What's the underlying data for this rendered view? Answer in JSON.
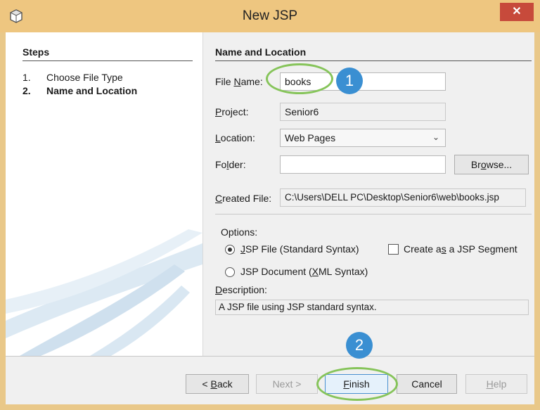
{
  "window": {
    "title": "New JSP",
    "close_glyph": "✕",
    "app_icon": "netbeans-cube-icon"
  },
  "steps": {
    "heading": "Steps",
    "items": [
      {
        "num": "1.",
        "label": "Choose File Type",
        "active": false
      },
      {
        "num": "2.",
        "label": "Name and Location",
        "active": true
      }
    ]
  },
  "form": {
    "heading": "Name and Location",
    "file_name": {
      "label_pre": "File ",
      "label_u": "N",
      "label_post": "ame:",
      "value": "books"
    },
    "project": {
      "label_u": "P",
      "label_post": "roject:",
      "value": "Senior6"
    },
    "location": {
      "label_u": "L",
      "label_post": "ocation:",
      "value": "Web Pages"
    },
    "folder": {
      "label_pre": "Fo",
      "label_u": "l",
      "label_post": "der:",
      "value": ""
    },
    "browse": {
      "label_pre": "Br",
      "label_u": "o",
      "label_post": "wse..."
    },
    "created_file": {
      "label_u": "C",
      "label_post": "reated File:",
      "value": "C:\\Users\\DELL PC\\Desktop\\Senior6\\web\\books.jsp"
    },
    "options_label": "Options:",
    "option_jsp_file": {
      "label_u": "J",
      "label_post": "SP File (Standard Syntax)",
      "selected": true
    },
    "option_jsp_segment": {
      "label_pre": "Create a",
      "label_u": "s",
      "label_post": " a JSP Segment",
      "checked": false
    },
    "option_jsp_document": {
      "label_pre": "JSP Document (",
      "label_u": "X",
      "label_post": "ML Syntax)",
      "selected": false
    },
    "description_label": {
      "label_u": "D",
      "label_post": "escription:"
    },
    "description_value": "A JSP file using JSP standard syntax."
  },
  "buttons": {
    "back": {
      "pre": "< ",
      "u": "B",
      "post": "ack"
    },
    "next": "Next >",
    "finish": {
      "u": "F",
      "post": "inish"
    },
    "cancel": "Cancel",
    "help": {
      "u": "H",
      "post": "elp"
    }
  },
  "callouts": {
    "one": "1",
    "two": "2"
  },
  "colors": {
    "titlebar": "#eec680",
    "close": "#c74a3b",
    "callout": "#3a8fd2",
    "ring": "#86c45a"
  }
}
